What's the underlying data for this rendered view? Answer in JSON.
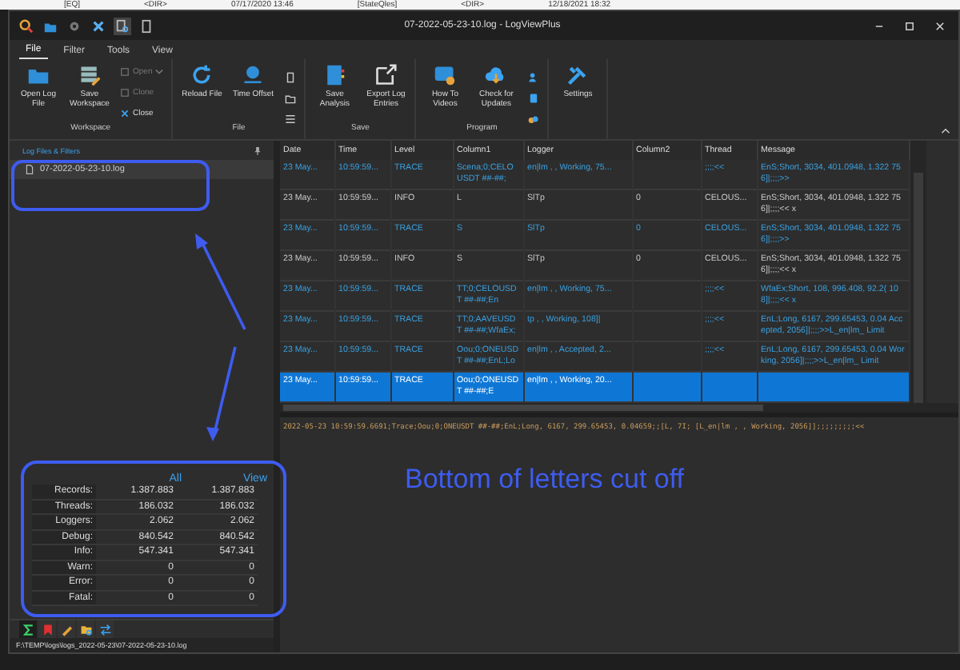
{
  "background_window": {
    "items": [
      "[EQ]",
      "<DIR>",
      "07/17/2020 13:46",
      "[StateQles]",
      "<DIR>",
      "12/18/2021 18:32"
    ]
  },
  "window": {
    "title": "07-2022-05-23-10.log - LogViewPlus"
  },
  "menu_tabs": [
    {
      "label": "File",
      "selected": true
    },
    {
      "label": "Filter",
      "selected": false
    },
    {
      "label": "Tools",
      "selected": false
    },
    {
      "label": "View",
      "selected": false
    }
  ],
  "ribbon": {
    "groups": [
      {
        "label": "Workspace",
        "buttons": [
          {
            "kind": "large",
            "label": "Open Log File"
          },
          {
            "kind": "large",
            "label": "Save Workspace"
          },
          {
            "kind": "small",
            "label": "Open",
            "disabled": true,
            "dropdown": true
          },
          {
            "kind": "small",
            "label": "Clone",
            "disabled": true,
            "dropdown": false
          },
          {
            "kind": "small",
            "label": "Close",
            "disabled": false,
            "dropdown": false
          }
        ]
      },
      {
        "label": "File",
        "buttons": [
          {
            "kind": "large",
            "label": "Reload File"
          },
          {
            "kind": "large",
            "label": "Time Offset"
          },
          {
            "kind": "mini"
          },
          {
            "kind": "mini"
          },
          {
            "kind": "mini"
          }
        ]
      },
      {
        "label": "Save",
        "buttons": [
          {
            "kind": "large",
            "label": "Save Analysis"
          },
          {
            "kind": "large",
            "label": "Export Log Entries"
          }
        ]
      },
      {
        "label": "Program",
        "buttons": [
          {
            "kind": "large",
            "label": "How To Videos"
          },
          {
            "kind": "large",
            "label": "Check for Updates"
          },
          {
            "kind": "mini"
          },
          {
            "kind": "mini"
          },
          {
            "kind": "mini"
          }
        ]
      },
      {
        "buttons": [
          {
            "kind": "large",
            "label": "Settings"
          }
        ]
      }
    ]
  },
  "files_panel": {
    "title": "Log Files & Filters",
    "files": [
      {
        "name": "07-2022-05-23-10.log",
        "selected": true
      }
    ]
  },
  "stats": {
    "columns": [
      "All",
      "View"
    ],
    "rows": [
      {
        "label": "Records:",
        "all": "1.387.883",
        "view": "1.387.883"
      },
      {
        "label": "Threads:",
        "all": "186.032",
        "view": "186.032"
      },
      {
        "label": "Loggers:",
        "all": "2.062",
        "view": "2.062"
      },
      {
        "label": "Debug:",
        "all": "840.542",
        "view": "840.542"
      },
      {
        "label": "Info:",
        "all": "547.341",
        "view": "547.341"
      },
      {
        "label": "Warn:",
        "all": "0",
        "view": "0"
      },
      {
        "label": "Error:",
        "all": "0",
        "view": "0"
      },
      {
        "label": "Fatal:",
        "all": "0",
        "view": "0"
      }
    ]
  },
  "panel_tabs": [
    {
      "selected": true
    },
    {
      "selected": false
    },
    {
      "selected": false
    },
    {
      "selected": false
    },
    {
      "selected": false
    }
  ],
  "status_path": "F:\\TEMP\\logs\\logs_2022-05-23\\07-2022-05-23-10.log",
  "table": {
    "columns": [
      "Date",
      "Time",
      "Level",
      "Column1",
      "Logger",
      "Column2",
      "Thread",
      "Message"
    ],
    "rows": [
      {
        "kind": "trace",
        "selected": false,
        "cells": [
          "23 May...",
          "10:59:59...",
          "TRACE",
          "Scena;0;CELOUSDT ##-##;",
          "en|lm , , Working, 75...",
          "",
          ";;;;<<",
          "EnS;Short, 3034, 401.0948, 1.322 756]|;;;;>>"
        ]
      },
      {
        "kind": "info",
        "selected": false,
        "cells": [
          "23 May...",
          "10:59:59...",
          "INFO",
          "L",
          "SlTp",
          "0",
          "CELOUS...",
          "EnS;Short, 3034, 401.0948, 1.322 756]|;;;;<< x"
        ]
      },
      {
        "kind": "trace",
        "selected": false,
        "cells": [
          "23 May...",
          "10:59:59...",
          "TRACE",
          "S",
          "SlTp",
          "0",
          "CELOUS...",
          "EnS;Short, 3034, 401.0948, 1.322 756]|;;;;>>"
        ]
      },
      {
        "kind": "info",
        "selected": false,
        "cells": [
          "23 May...",
          "10:59:59...",
          "INFO",
          "S",
          "SlTp",
          "0",
          "CELOUS...",
          "EnS;Short, 3034, 401.0948, 1.322 756]|;;;;<< x"
        ]
      },
      {
        "kind": "trace",
        "selected": false,
        "cells": [
          "23 May...",
          "10:59:59...",
          "TRACE",
          "TT;0;CELOUSDT ##-##;En",
          "en|lm , , Working, 75...",
          "",
          ";;;;<<",
          "WfaEx;Short, 108, 996.408, 92.2( 108]|;;;;<< x"
        ]
      },
      {
        "kind": "trace",
        "selected": false,
        "cells": [
          "23 May...",
          "10:59:59...",
          "TRACE",
          "TT;0;AAVEUSDT ##-##;WfaEx;",
          "tp , , Working, 108]|",
          "",
          ";;;;<<",
          "EnL;Long, 6167, 299.65453, 0.04 Accepted, 2056]|;;;;>>L_en|lm_ Limit"
        ]
      },
      {
        "kind": "trace",
        "selected": false,
        "cells": [
          "23 May...",
          "10:59:59...",
          "TRACE",
          "Oou;0;ONEUSDT ##-##;EnL;Lo",
          "en|lm , , Accepted, 2...",
          "",
          ";;;;<<",
          "EnL;Long, 6167, 299.65453, 0.04 Working, 2056]|;;;;>>L_en|lm_ Limit"
        ]
      },
      {
        "kind": "trace",
        "selected": true,
        "cells": [
          "23 May...",
          "10:59:59...",
          "TRACE",
          "Oou;0;ONEUSDT ##-##;E",
          "en|lm , , Working, 20...",
          "",
          "",
          ""
        ]
      }
    ]
  },
  "detail": {
    "text": "2022-05-23 10:59:59.6691;Trace;Oou;0;ONEUSDT ##-##;EnL;Long, 6167, 299.65453, 0.04659;;[L, 7I;    [L_en|lm , , Working, 2056]];;;;;;;;;<<"
  },
  "annotation": {
    "note": "Bottom of letters cut off"
  }
}
